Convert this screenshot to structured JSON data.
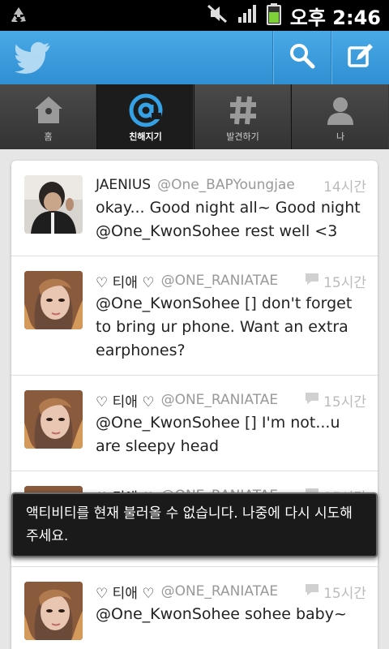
{
  "status_bar": {
    "time": "오후 2:46",
    "icons": [
      "recycle-icon",
      "mute-icon",
      "signal-icon",
      "battery-icon"
    ]
  },
  "action_bar": {
    "logo": "twitter-bird-icon",
    "buttons": [
      "search-icon",
      "compose-icon"
    ],
    "accent": "#3a9ad9"
  },
  "tabs": [
    {
      "label": "홈",
      "icon": "home-icon",
      "active": false
    },
    {
      "label": "친해지기",
      "icon": "at-icon",
      "active": true
    },
    {
      "label": "발견하기",
      "icon": "hash-icon",
      "active": false
    },
    {
      "label": "나",
      "icon": "person-icon",
      "active": false
    }
  ],
  "tweets": [
    {
      "name": "JAENIUS",
      "handle": "@One_BAPYoungjae",
      "time": "14시간",
      "text": "okay... Good night all~ Good night @One_KwonSohee rest well <3",
      "has_reply_icon": false
    },
    {
      "name": "♡ 티애 ♡",
      "handle": "@ONE_RANIATAE",
      "time": "15시간",
      "text": "@One_KwonSohee [] don't forget to bring ur phone. Want an extra earphones?",
      "has_reply_icon": true
    },
    {
      "name": "♡ 티애 ♡",
      "handle": "@ONE_RANIATAE",
      "time": "15시간",
      "text": "@One_KwonSohee [] I'm not...u are sleepy head",
      "has_reply_icon": true
    },
    {
      "name": "♡ 티애 ♡",
      "handle": "@ONE_RANIATAE",
      "time": "15시간",
      "text": "",
      "has_reply_icon": true
    },
    {
      "name": "♡ 티애 ♡",
      "handle": "@ONE_RANIATAE",
      "time": "15시간",
      "text": "@One_KwonSohee sohee baby~",
      "has_reply_icon": true
    }
  ],
  "toast": {
    "message": "액티비티를 현재 불러올 수 없습니다. 나중에 다시 시도해주세요."
  }
}
